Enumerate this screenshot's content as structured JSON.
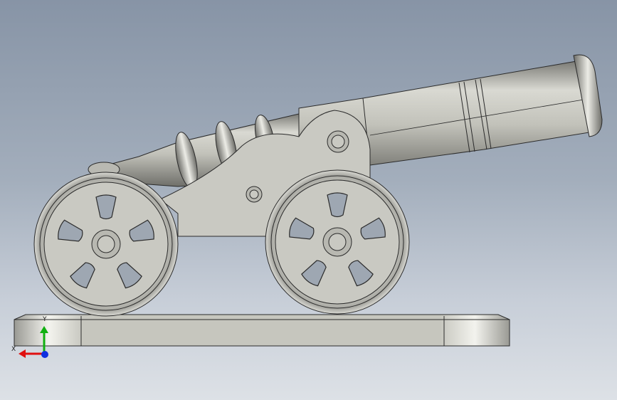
{
  "viewport": {
    "model": "cannon-model",
    "background": [
      "#8794a6",
      "#dde1e6"
    ],
    "colors": {
      "part_fill": "#c9c9c2",
      "part_shadow": "#8e8e88",
      "edge": "#2b2b2b",
      "axis_x": "#e01010",
      "axis_y": "#10b010",
      "axis_z": "#1030e0"
    }
  },
  "triad": {
    "x_label": "X",
    "y_label": "Y"
  }
}
